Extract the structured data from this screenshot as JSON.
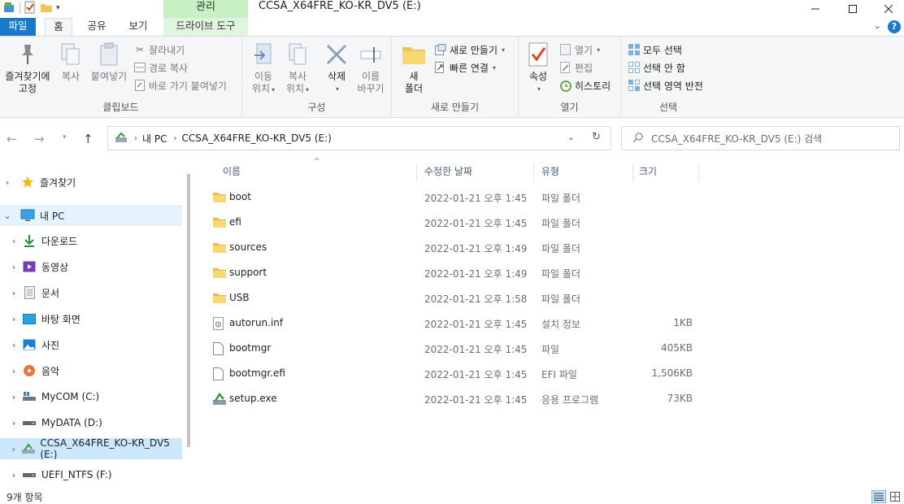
{
  "titlebar": {
    "context_tab": "관리",
    "window_title": "CCSA_X64FRE_KO-KR_DV5 (E:)"
  },
  "tabs": {
    "file": "파일",
    "home": "홈",
    "share": "공유",
    "view": "보기",
    "drive_tools": "드라이브 도구"
  },
  "ribbon": {
    "clipboard": {
      "label": "클립보드",
      "pin": "즐겨찾기에\n고정",
      "pin_line1": "즐겨찾기에",
      "pin_line2": "고정",
      "copy": "복사",
      "paste": "붙여넣기",
      "cut": "잘라내기",
      "copy_path": "경로 복사",
      "paste_shortcut": "바로 가기 붙여넣기"
    },
    "organize": {
      "label": "구성",
      "move_line1": "이동",
      "move_line2": "위치",
      "copy_line1": "복사",
      "copy_line2": "위치",
      "delete": "삭제",
      "rename_line1": "이름",
      "rename_line2": "바꾸기"
    },
    "new": {
      "label": "새로 만들기",
      "folder_line1": "새",
      "folder_line2": "폴더",
      "new_item": "새로 만들기",
      "easy_access": "빠른 연결"
    },
    "open": {
      "label": "열기",
      "properties": "속성",
      "open": "열기",
      "edit": "편집",
      "history": "히스토리"
    },
    "select": {
      "label": "선택",
      "select_all": "모두 선택",
      "select_none": "선택 안 함",
      "invert": "선택 영역 반전"
    }
  },
  "address": {
    "crumbs": [
      "내 PC",
      "CCSA_X64FRE_KO-KR_DV5 (E:)"
    ],
    "search_placeholder": "CCSA_X64FRE_KO-KR_DV5 (E:) 검색"
  },
  "navpane": {
    "items": [
      {
        "label": "즐겨찾기",
        "icon": "star-icon"
      },
      {
        "label": "내 PC",
        "icon": "pc-icon"
      },
      {
        "label": "다운로드",
        "icon": "download-icon"
      },
      {
        "label": "동영상",
        "icon": "video-icon"
      },
      {
        "label": "문서",
        "icon": "document-icon"
      },
      {
        "label": "바탕 화면",
        "icon": "desktop-icon"
      },
      {
        "label": "사진",
        "icon": "picture-icon"
      },
      {
        "label": "음악",
        "icon": "music-icon"
      },
      {
        "label": "MyCOM (C:)",
        "icon": "drive-icon"
      },
      {
        "label": "MyDATA (D:)",
        "icon": "drive-icon"
      },
      {
        "label": "CCSA_X64FRE_KO-KR_DV5 (E:)",
        "icon": "dvd-drive-icon"
      },
      {
        "label": "UEFI_NTFS (F:)",
        "icon": "drive-icon"
      }
    ]
  },
  "filelist": {
    "columns": {
      "name": "이름",
      "date": "수정한 날짜",
      "type": "유형",
      "size": "크기"
    },
    "rows": [
      {
        "name": "boot",
        "date": "2022-01-21 오후 1:45",
        "type": "파일 폴더",
        "size": "",
        "icon": "folder-icon"
      },
      {
        "name": "efi",
        "date": "2022-01-21 오후 1:45",
        "type": "파일 폴더",
        "size": "",
        "icon": "folder-icon"
      },
      {
        "name": "sources",
        "date": "2022-01-21 오후 1:49",
        "type": "파일 폴더",
        "size": "",
        "icon": "folder-icon"
      },
      {
        "name": "support",
        "date": "2022-01-21 오후 1:49",
        "type": "파일 폴더",
        "size": "",
        "icon": "folder-icon"
      },
      {
        "name": "USB",
        "date": "2022-01-21 오후 1:58",
        "type": "파일 폴더",
        "size": "",
        "icon": "folder-icon"
      },
      {
        "name": "autorun.inf",
        "date": "2022-01-21 오후 1:45",
        "type": "설치 정보",
        "size": "1KB",
        "icon": "setup-info-icon"
      },
      {
        "name": "bootmgr",
        "date": "2022-01-21 오후 1:45",
        "type": "파일",
        "size": "405KB",
        "icon": "file-icon"
      },
      {
        "name": "bootmgr.efi",
        "date": "2022-01-21 오후 1:45",
        "type": "EFI 파일",
        "size": "1,506KB",
        "icon": "file-icon"
      },
      {
        "name": "setup.exe",
        "date": "2022-01-21 오후 1:45",
        "type": "응용 프로그램",
        "size": "73KB",
        "icon": "setup-exe-icon"
      }
    ]
  },
  "status": {
    "item_count": "9개 항목"
  },
  "colors": {
    "file_tab": "#1979ca",
    "context_tab": "#c7f0c4",
    "selection": "#cce8ff",
    "folder": "#f2c55c"
  }
}
